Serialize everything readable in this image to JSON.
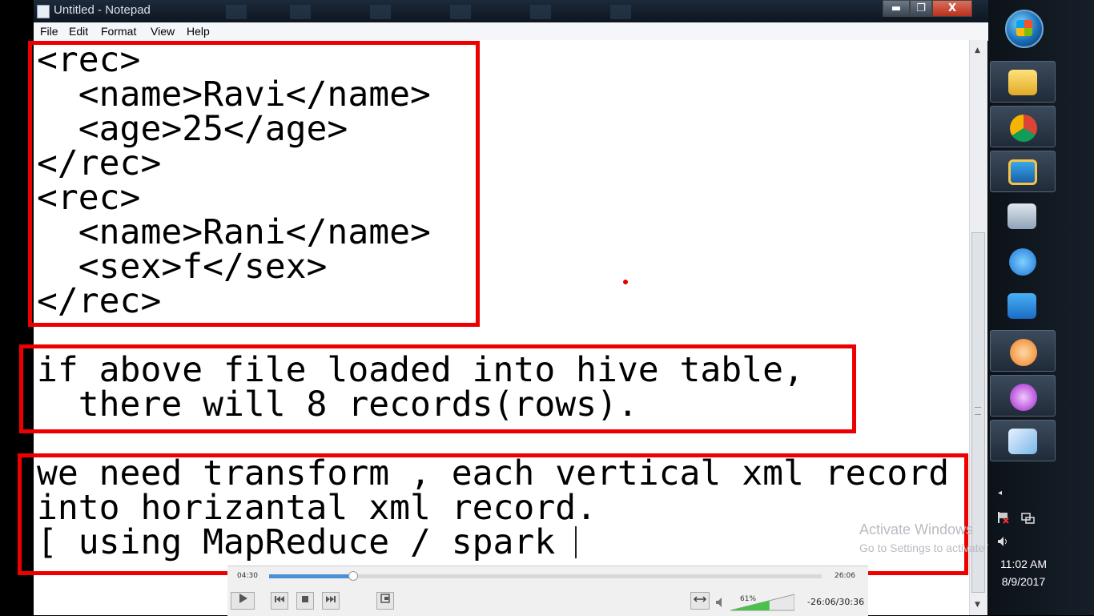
{
  "window": {
    "title": "Untitled - Notepad",
    "min_glyph": "▬",
    "max_glyph": "❐",
    "close_glyph": "X"
  },
  "menu": [
    "File",
    "Edit",
    "Format",
    "View",
    "Help"
  ],
  "editor": {
    "lines": [
      "<rec>",
      "  <name>Ravi</name>",
      "  <age>25</age>",
      "</rec>",
      "<rec>",
      "  <name>Rani</name>",
      "  <sex>f</sex>",
      "</rec>",
      "if above file loaded into hive table,",
      "  there will 8 records(rows).",
      "we need transform , each vertical xml record",
      "into horizantal xml record.",
      "[ using MapReduce / spark "
    ]
  },
  "watermark": {
    "title": "Activate Windows",
    "subtitle": "Go to Settings to activate Windows."
  },
  "player": {
    "elapsed": "04:30",
    "remaining": "26:06",
    "progress_fraction": 0.15,
    "volume_label": "61%",
    "volume_fraction": 0.61,
    "time_display": "-26:06/30:36",
    "buttons": [
      "play-icon",
      "previous-icon",
      "stop-icon",
      "next-icon",
      "fullscreen-icon",
      "loop-icon",
      "speaker-icon"
    ]
  },
  "taskbar": {
    "items": [
      "start-orb",
      "file-explorer-icon",
      "chrome-icon",
      "virtualbox-icon",
      "image-viewer-icon",
      "internet-explorer-icon",
      "media-player-icon",
      "app-flower-orange-icon",
      "app-flower-purple-icon",
      "notepad-icon"
    ],
    "clock_time": "11:02 AM",
    "clock_date": "8/9/2017",
    "show_hidden_glyph": "◂"
  },
  "colors": {
    "highlight_box": "#ee0000",
    "taskbar": "#0c1218",
    "titlebar": "#1c2a3a"
  }
}
